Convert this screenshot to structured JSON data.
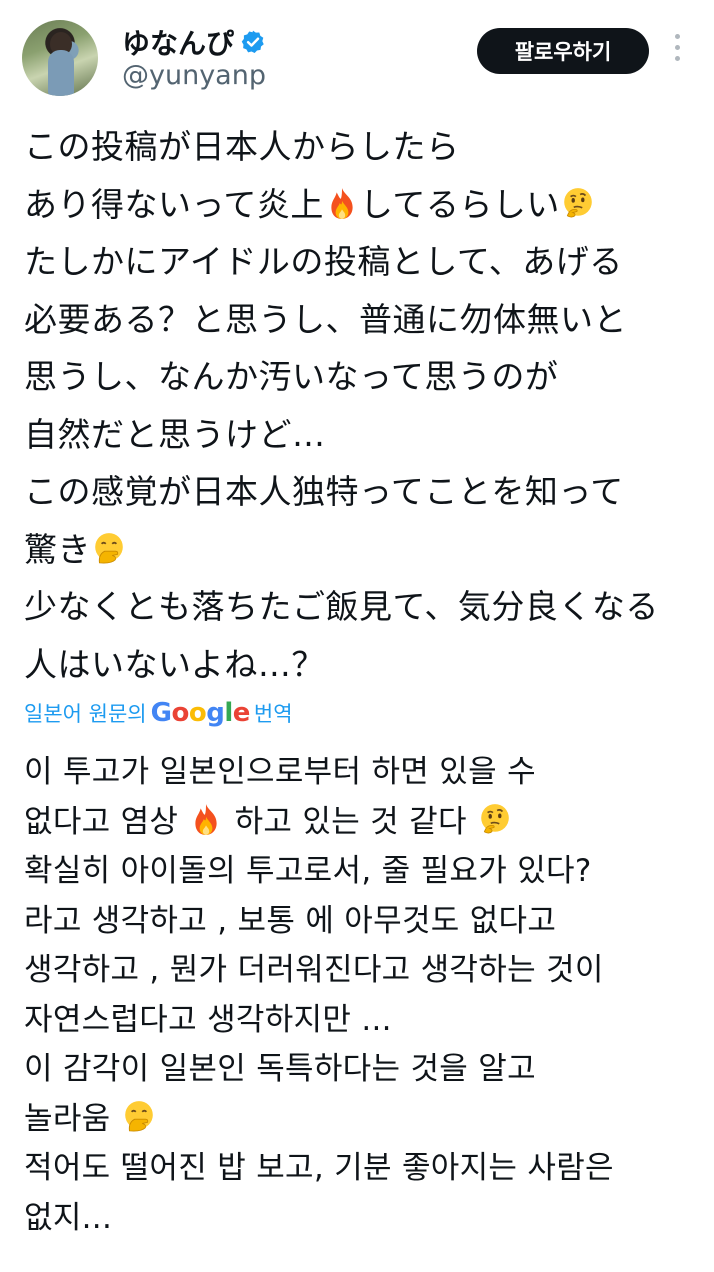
{
  "profile": {
    "display_name": "ゆなんぴ",
    "handle": "@yunyanp",
    "follow_label": "팔로우하기",
    "verified_icon": "verified-badge-icon",
    "verified_color": "#1d9bf0",
    "more_icon": "more-vertical-icon"
  },
  "post": {
    "original_lines": [
      "この投稿が日本人からしたら",
      "あり得ないって炎上",
      "してるらしい",
      "たしかにアイドルの投稿として、あげる",
      "必要ある？と思うし、普通に勿体無いと",
      "思うし、なんか汚いなって思うのが",
      "自然だと思うけど…",
      "この感覚が日本人独特ってことを知って",
      "驚き",
      "少なくとも落ちたご飯見て、気分良くなる",
      "人はいないよね…？"
    ],
    "translate_prefix": "일본어 원문의",
    "translate_brand": "Google",
    "translate_suffix": "번역",
    "translated_lines": [
      "이 투고가 일본인으로부터 하면 있을 수",
      "없다고 염상",
      "하고 있는 것 같다",
      "확실히 아이돌의 투고로서, 줄 필요가 있다?",
      "라고 생각하고 , 보통 에 아무것도 없다고",
      "생각하고 , 뭔가 더러워진다고 생각하는 것이",
      "자연스럽다고 생각하지만 ...",
      "이 감각이 일본인 독특하다는 것을 알고",
      "놀라움",
      "적어도 떨어진 밥 보고, 기분 좋아지는 사람은",
      "없지..."
    ],
    "emoji": {
      "fire": "fire-emoji-icon",
      "thinking": "thinking-face-emoji-icon",
      "hand_over_mouth": "face-with-hand-over-mouth-emoji-icon"
    },
    "colors": {
      "link_blue": "#1d9bf0",
      "text": "#0f1419",
      "secondary": "#536471"
    }
  }
}
